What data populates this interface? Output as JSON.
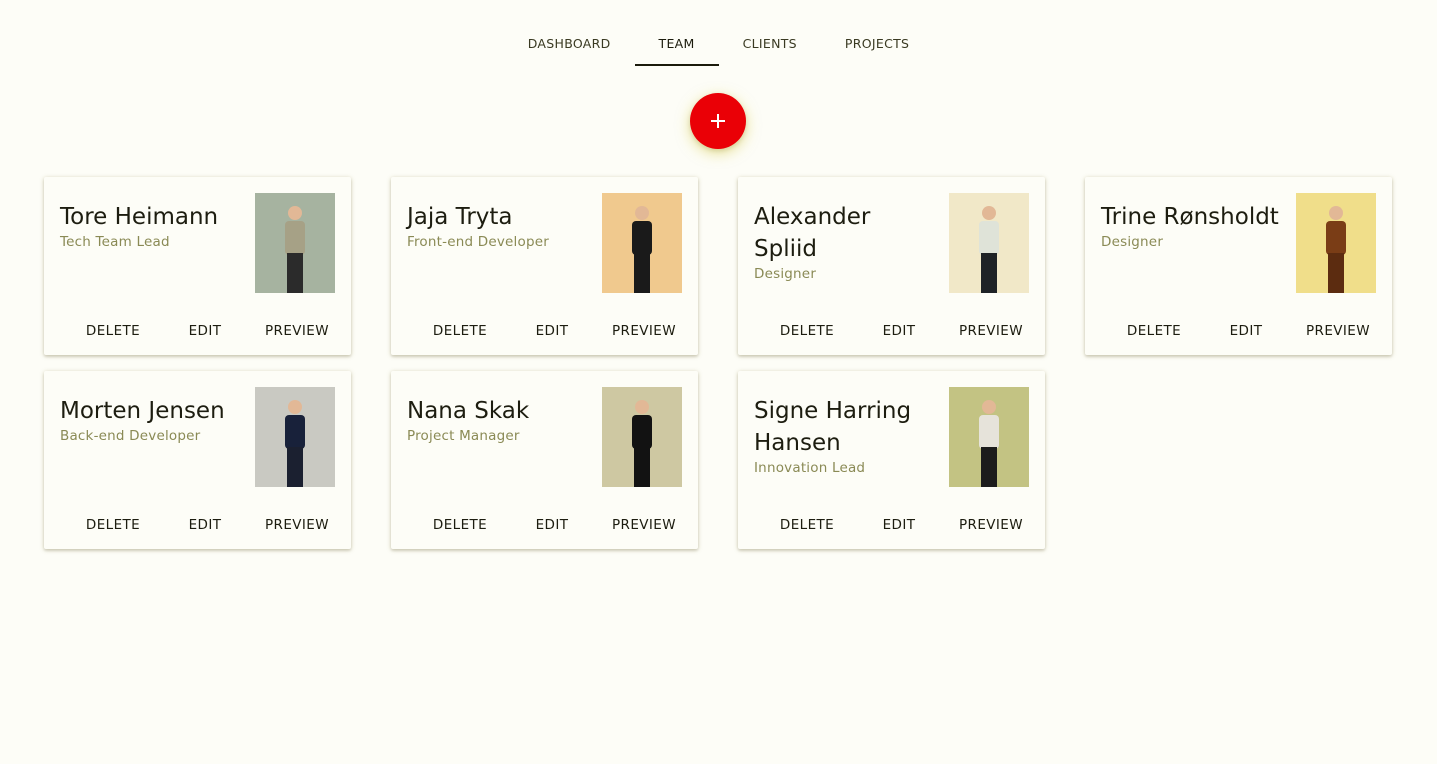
{
  "nav": {
    "tabs": [
      {
        "label": "DASHBOARD"
      },
      {
        "label": "TEAM"
      },
      {
        "label": "CLIENTS"
      },
      {
        "label": "PROJECTS"
      }
    ],
    "active": "TEAM"
  },
  "fab": {
    "icon": "plus-icon",
    "color": "#ea0006"
  },
  "actions": {
    "delete": "DELETE",
    "edit": "EDIT",
    "preview": "PREVIEW"
  },
  "members": [
    {
      "name": "Tore Heimann",
      "role": "Tech Team Lead",
      "photo_bg": "#a6b3a0",
      "shirt": "#a6a186",
      "pants": "#2b2b2b"
    },
    {
      "name": "Jaja Tryta",
      "role": "Front-end Developer",
      "photo_bg": "#f0c98e",
      "shirt": "#1a1a1a",
      "pants": "#1a1a1a"
    },
    {
      "name": "Alexander Spliid",
      "role": "Designer",
      "photo_bg": "#f1e8c8",
      "shirt": "#dfe3d8",
      "pants": "#1e2226"
    },
    {
      "name": "Trine Rønsholdt",
      "role": "Designer",
      "photo_bg": "#f0de8a",
      "shirt": "#7a3d16",
      "pants": "#5c2c10"
    },
    {
      "name": "Morten Jensen",
      "role": "Back-end Developer",
      "photo_bg": "#c9c9c2",
      "shirt": "#18213a",
      "pants": "#1b2030"
    },
    {
      "name": "Nana Skak",
      "role": "Project Manager",
      "photo_bg": "#cec8a2",
      "shirt": "#121212",
      "pants": "#121212"
    },
    {
      "name": "Signe Harring Hansen",
      "role": "Innovation Lead",
      "photo_bg": "#c3c383",
      "shirt": "#e6e3da",
      "pants": "#1c1c1c"
    }
  ]
}
